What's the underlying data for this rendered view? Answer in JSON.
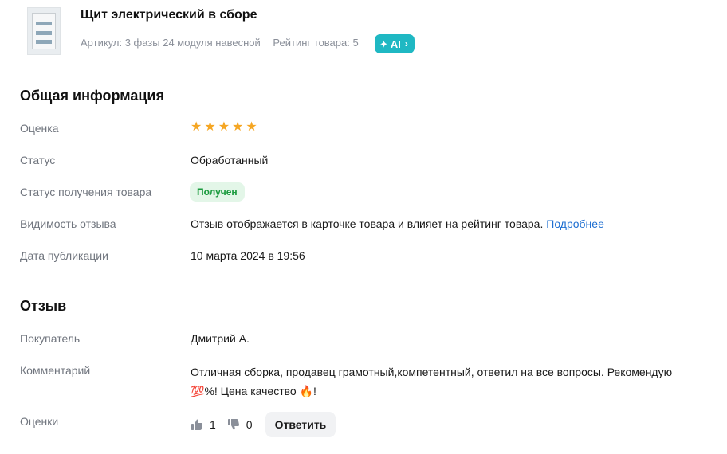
{
  "product": {
    "title": "Щит электрический в сборе",
    "article": "Артикул: 3 фазы 24 модуля навесной",
    "rating": "Рейтинг товара: 5",
    "ai_label": "AI"
  },
  "general": {
    "heading": "Общая информация",
    "rows": {
      "score_label": "Оценка",
      "score_value": 5,
      "status_label": "Статус",
      "status_value": "Обработанный",
      "receipt_label": "Статус получения товара",
      "receipt_value": "Получен",
      "visibility_label": "Видимость отзыва",
      "visibility_value": "Отзыв отображается в карточке товара и влияет на рейтинг товара.",
      "visibility_link": "Подробнее",
      "date_label": "Дата публикации",
      "date_value": "10 марта 2024 в 19:56"
    }
  },
  "review": {
    "heading": "Отзыв",
    "buyer_label": "Покупатель",
    "buyer_value": "Дмитрий А.",
    "comment_label": "Комментарий",
    "comment_text_1": "Отличная сборка, продавец грамотный,компетентный, ответил на все вопросы. Рекомендую",
    "comment_emoji_1": "💯",
    "comment_text_2": "%! Цена качество",
    "comment_emoji_2": "🔥",
    "comment_text_3": "!",
    "votes_label": "Оценки",
    "likes": "1",
    "dislikes": "0",
    "reply_label": "Ответить"
  },
  "colors": {
    "accent_link": "#1f6fd1",
    "ai_badge": "#1fb8c3",
    "star": "#f5a623",
    "received_bg": "#e3f6e8",
    "received_text": "#1a9a3e"
  },
  "icons": [
    "sparkle-icon",
    "chevron-right-icon",
    "star-icon",
    "thumbs-up-icon",
    "thumbs-down-icon"
  ]
}
